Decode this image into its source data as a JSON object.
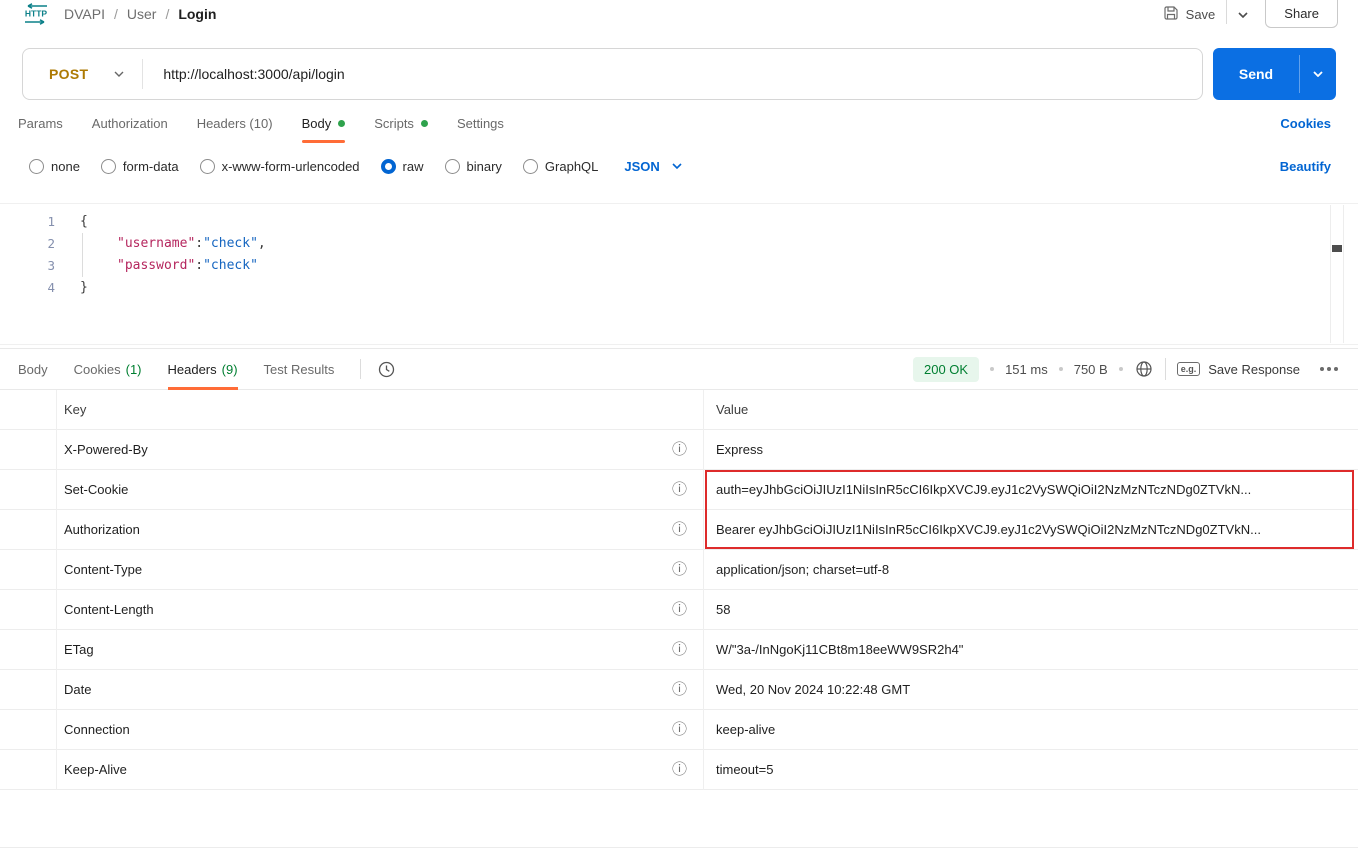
{
  "colors": {
    "accent_orange": "#FF6C37",
    "method_post": "#AD7A03",
    "link_blue": "#0265D2",
    "send_blue": "#0B6FE3",
    "success_green": "#007F31",
    "tab_dot_green": "#2EA24C",
    "highlight_red": "#DE2B2B",
    "http_icon_teal": "#0C8089",
    "code_key": "#B5265E",
    "code_string": "#1565C0"
  },
  "icons": {
    "info": "ⓘ"
  },
  "topbar": {
    "http_icon_label": "HTTP",
    "breadcrumb": {
      "items": [
        "DVAPI",
        "User",
        "Login"
      ],
      "separator": "/"
    },
    "save_label": "Save",
    "share_label": "Share"
  },
  "request": {
    "method": "POST",
    "url": "http://localhost:3000/api/login",
    "send_label": "Send",
    "tabs": [
      {
        "label": "Params",
        "active": false,
        "dot": false
      },
      {
        "label": "Authorization",
        "active": false,
        "dot": false
      },
      {
        "label": "Headers (10)",
        "active": false,
        "dot": false
      },
      {
        "label": "Body",
        "active": true,
        "dot": true
      },
      {
        "label": "Scripts",
        "active": false,
        "dot": true
      },
      {
        "label": "Settings",
        "active": false,
        "dot": false
      }
    ],
    "cookies_link": "Cookies",
    "body_modes": [
      "none",
      "form-data",
      "x-www-form-urlencoded",
      "raw",
      "binary",
      "GraphQL"
    ],
    "selected_mode": "raw",
    "language": "JSON",
    "beautify_link": "Beautify"
  },
  "editor": {
    "line_numbers": [
      "1",
      "2",
      "3",
      "4"
    ],
    "open_brace": "{",
    "close_brace": "}",
    "entries": [
      {
        "key": "\"username\"",
        "colon": ":",
        "value": "\"check\"",
        "comma": ","
      },
      {
        "key": "\"password\"",
        "colon": ":",
        "value": "\"check\"",
        "comma": ""
      }
    ]
  },
  "response": {
    "tabs": [
      {
        "label": "Body",
        "count": "",
        "active": false
      },
      {
        "label": "Cookies",
        "count": "(1)",
        "active": false
      },
      {
        "label": "Headers",
        "count": "(9)",
        "active": true
      },
      {
        "label": "Test Results",
        "count": "",
        "active": false
      }
    ],
    "status_badge": "200 OK",
    "time": "151 ms",
    "size": "750 B",
    "example_badge": "e.g.",
    "save_response_label": "Save Response",
    "table": {
      "columns": [
        "Key",
        "Value"
      ],
      "rows": [
        {
          "key": "X-Powered-By",
          "value": "Express",
          "highlighted": false
        },
        {
          "key": "Set-Cookie",
          "value": "auth=eyJhbGciOiJIUzI1NiIsInR5cCI6IkpXVCJ9.eyJ1c2VySWQiOiI2NzMzNTczNDg0ZTVkN...",
          "highlighted": true
        },
        {
          "key": "Authorization",
          "value": "Bearer eyJhbGciOiJIUzI1NiIsInR5cCI6IkpXVCJ9.eyJ1c2VySWQiOiI2NzMzNTczNDg0ZTVkN...",
          "highlighted": true
        },
        {
          "key": "Content-Type",
          "value": "application/json; charset=utf-8",
          "highlighted": false
        },
        {
          "key": "Content-Length",
          "value": "58",
          "highlighted": false
        },
        {
          "key": "ETag",
          "value": "W/\"3a-/InNgoKj11CBt8m18eeWW9SR2h4\"",
          "highlighted": false
        },
        {
          "key": "Date",
          "value": "Wed, 20 Nov 2024 10:22:48 GMT",
          "highlighted": false
        },
        {
          "key": "Connection",
          "value": "keep-alive",
          "highlighted": false
        },
        {
          "key": "Keep-Alive",
          "value": "timeout=5",
          "highlighted": false
        }
      ]
    }
  }
}
